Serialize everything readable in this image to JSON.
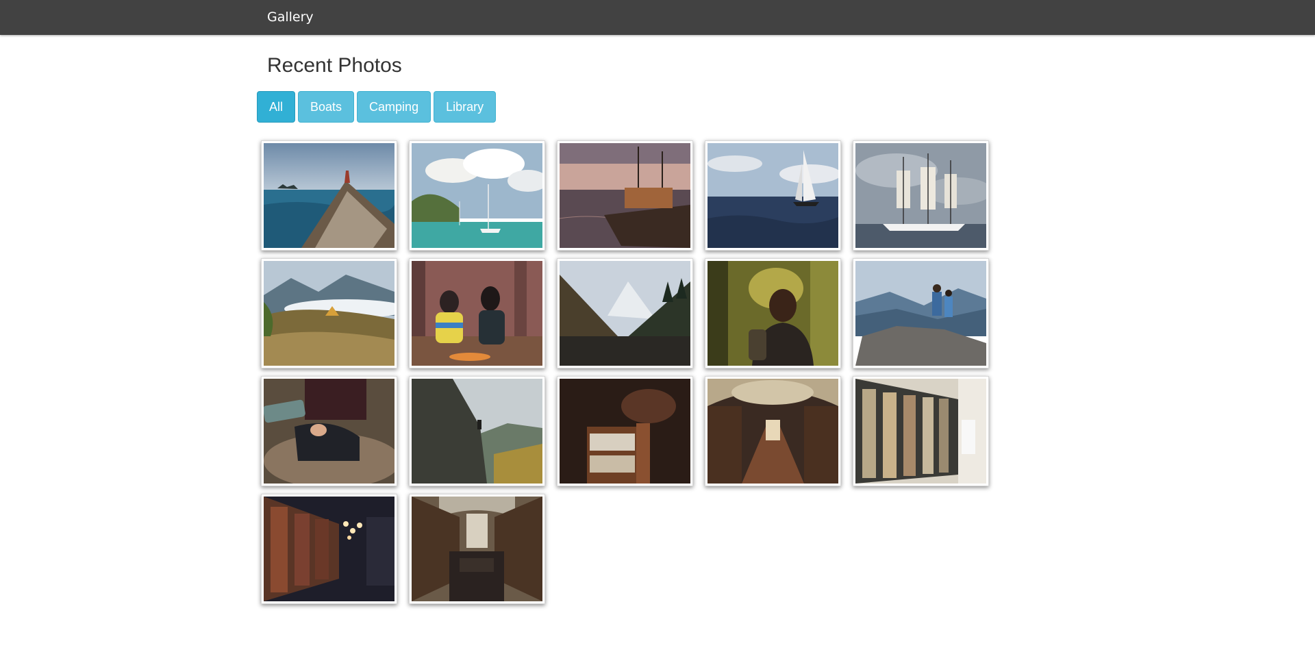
{
  "navbar": {
    "brand": "Gallery"
  },
  "page": {
    "title": "Recent Photos"
  },
  "filters": [
    {
      "label": "All",
      "active": true
    },
    {
      "label": "Boats",
      "active": false
    },
    {
      "label": "Camping",
      "active": false
    },
    {
      "label": "Library",
      "active": false
    }
  ],
  "photos": [
    {
      "category": "boats",
      "subject": "wooden-boat-bow-at-sea"
    },
    {
      "category": "boats",
      "subject": "sailboats-in-turquoise-bay"
    },
    {
      "category": "boats",
      "subject": "old-fishing-boat-at-sunset"
    },
    {
      "category": "boats",
      "subject": "sailboat-on-open-sea"
    },
    {
      "category": "boats",
      "subject": "tall-ship-under-clouds"
    },
    {
      "category": "camping",
      "subject": "tent-above-clouds-mountains"
    },
    {
      "category": "camping",
      "subject": "friends-at-campfire-in-forest"
    },
    {
      "category": "camping",
      "subject": "mountain-valley-with-pines"
    },
    {
      "category": "camping",
      "subject": "hiker-with-backpack-in-woods"
    },
    {
      "category": "camping",
      "subject": "couple-on-rocky-overlook"
    },
    {
      "category": "camping",
      "subject": "pouring-from-thermos"
    },
    {
      "category": "camping",
      "subject": "person-on-cliff-edge"
    },
    {
      "category": "library",
      "subject": "dark-wooden-bookshelves"
    },
    {
      "category": "library",
      "subject": "ornate-baroque-library-hall"
    },
    {
      "category": "library",
      "subject": "modern-library-stacks"
    },
    {
      "category": "library",
      "subject": "library-aisle-with-lights"
    },
    {
      "category": "library",
      "subject": "grand-library-reading-room"
    }
  ]
}
